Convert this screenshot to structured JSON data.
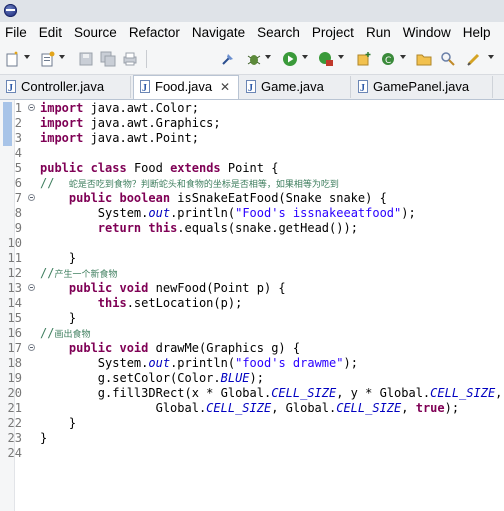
{
  "menubar": {
    "items": [
      "File",
      "Edit",
      "Source",
      "Refactor",
      "Navigate",
      "Search",
      "Project",
      "Run",
      "Window",
      "Help"
    ]
  },
  "toolbar": {
    "icons": [
      "new-icon",
      "new-class-icon",
      "save-icon",
      "save-all-icon",
      "print-icon",
      "pin-icon",
      "debug-icon",
      "run-icon",
      "run-external-icon",
      "new-java-class-icon",
      "open-type-icon",
      "open-folder-icon",
      "search-icon"
    ]
  },
  "tabs": [
    {
      "label": "Controller.java",
      "active": false
    },
    {
      "label": "Food.java",
      "active": true,
      "close": "✕"
    },
    {
      "label": "Game.java",
      "active": false
    },
    {
      "label": "GamePanel.java",
      "active": false
    }
  ],
  "editor": {
    "lines": [
      {
        "n": "1",
        "fold": "⊖",
        "tokens": [
          {
            "t": "import",
            "c": "kw"
          },
          {
            "t": " java.awt.Color;",
            "c": "plain"
          }
        ]
      },
      {
        "n": "2",
        "tokens": [
          {
            "t": "import",
            "c": "kw"
          },
          {
            "t": " java.awt.Graphics;",
            "c": "plain"
          }
        ]
      },
      {
        "n": "3",
        "tokens": [
          {
            "t": "import",
            "c": "kw"
          },
          {
            "t": " java.awt.Point;",
            "c": "plain"
          }
        ]
      },
      {
        "n": "4",
        "tokens": []
      },
      {
        "n": "5",
        "tokens": [
          {
            "t": "public",
            "c": "kw"
          },
          {
            "t": " ",
            "c": "plain"
          },
          {
            "t": "class",
            "c": "kw"
          },
          {
            "t": " Food ",
            "c": "plain"
          },
          {
            "t": "extends",
            "c": "kw"
          },
          {
            "t": " Point {",
            "c": "plain"
          }
        ]
      },
      {
        "n": "6",
        "tokens": [
          {
            "t": "//  ",
            "c": "cmt"
          },
          {
            "t": "蛇是否吃到食物？判断蛇头和食物的坐标是否相等，如果相等为吃到",
            "c": "cmtcn"
          }
        ]
      },
      {
        "n": "7",
        "fold": "⊖",
        "tokens": [
          {
            "t": "    public",
            "c": "kw"
          },
          {
            "t": " ",
            "c": "plain"
          },
          {
            "t": "boolean",
            "c": "kw"
          },
          {
            "t": " isSnakeEatFood(Snake snake) {",
            "c": "plain"
          }
        ]
      },
      {
        "n": "8",
        "tokens": [
          {
            "t": "        System.",
            "c": "plain"
          },
          {
            "t": "out",
            "c": "fld"
          },
          {
            "t": ".println(",
            "c": "plain"
          },
          {
            "t": "\"Food's issnakeeatfood\"",
            "c": "str"
          },
          {
            "t": ");",
            "c": "plain"
          }
        ]
      },
      {
        "n": "9",
        "tokens": [
          {
            "t": "        return",
            "c": "kw"
          },
          {
            "t": " ",
            "c": "plain"
          },
          {
            "t": "this",
            "c": "kw"
          },
          {
            "t": ".equals(snake.getHead());",
            "c": "plain"
          }
        ]
      },
      {
        "n": "10",
        "tokens": []
      },
      {
        "n": "11",
        "tokens": [
          {
            "t": "    }",
            "c": "plain"
          }
        ]
      },
      {
        "n": "12",
        "tokens": [
          {
            "t": "//",
            "c": "cmt"
          },
          {
            "t": "产生一个新食物",
            "c": "cmtcn"
          }
        ]
      },
      {
        "n": "13",
        "fold": "⊖",
        "tokens": [
          {
            "t": "    public",
            "c": "kw"
          },
          {
            "t": " ",
            "c": "plain"
          },
          {
            "t": "void",
            "c": "kw"
          },
          {
            "t": " newFood(Point p) {",
            "c": "plain"
          }
        ]
      },
      {
        "n": "14",
        "tokens": [
          {
            "t": "        this",
            "c": "kw"
          },
          {
            "t": ".setLocation(p);",
            "c": "plain"
          }
        ]
      },
      {
        "n": "15",
        "tokens": [
          {
            "t": "    }",
            "c": "plain"
          }
        ]
      },
      {
        "n": "16",
        "tokens": [
          {
            "t": "//",
            "c": "cmt"
          },
          {
            "t": "画出食物",
            "c": "cmtcn"
          }
        ]
      },
      {
        "n": "17",
        "fold": "⊖",
        "tokens": [
          {
            "t": "    public",
            "c": "kw"
          },
          {
            "t": " ",
            "c": "plain"
          },
          {
            "t": "void",
            "c": "kw"
          },
          {
            "t": " drawMe(Graphics g) {",
            "c": "plain"
          }
        ]
      },
      {
        "n": "18",
        "tokens": [
          {
            "t": "        System.",
            "c": "plain"
          },
          {
            "t": "out",
            "c": "fld"
          },
          {
            "t": ".println(",
            "c": "plain"
          },
          {
            "t": "\"food's drawme\"",
            "c": "str"
          },
          {
            "t": ");",
            "c": "plain"
          }
        ]
      },
      {
        "n": "19",
        "tokens": [
          {
            "t": "        g.setColor(Color.",
            "c": "plain"
          },
          {
            "t": "BLUE",
            "c": "fld"
          },
          {
            "t": ");",
            "c": "plain"
          }
        ]
      },
      {
        "n": "20",
        "tokens": [
          {
            "t": "        g.fill3DRect(x * Global.",
            "c": "plain"
          },
          {
            "t": "CELL_SIZE",
            "c": "fld"
          },
          {
            "t": ", y * Global.",
            "c": "plain"
          },
          {
            "t": "CELL_SIZE",
            "c": "fld"
          },
          {
            "t": ",",
            "c": "plain"
          }
        ]
      },
      {
        "n": "21",
        "tokens": [
          {
            "t": "                Global.",
            "c": "plain"
          },
          {
            "t": "CELL_SIZE",
            "c": "fld"
          },
          {
            "t": ", Global.",
            "c": "plain"
          },
          {
            "t": "CELL_SIZE",
            "c": "fld"
          },
          {
            "t": ", ",
            "c": "plain"
          },
          {
            "t": "true",
            "c": "kw"
          },
          {
            "t": ");",
            "c": "plain"
          }
        ]
      },
      {
        "n": "22",
        "tokens": [
          {
            "t": "    }",
            "c": "plain"
          }
        ]
      },
      {
        "n": "23",
        "tokens": [
          {
            "t": "}",
            "c": "plain"
          }
        ]
      },
      {
        "n": "24",
        "tokens": []
      }
    ]
  },
  "colors": {
    "keyword": "#7f0055",
    "string": "#2a00ff",
    "comment": "#3f7f5f",
    "field": "#0000c0"
  }
}
